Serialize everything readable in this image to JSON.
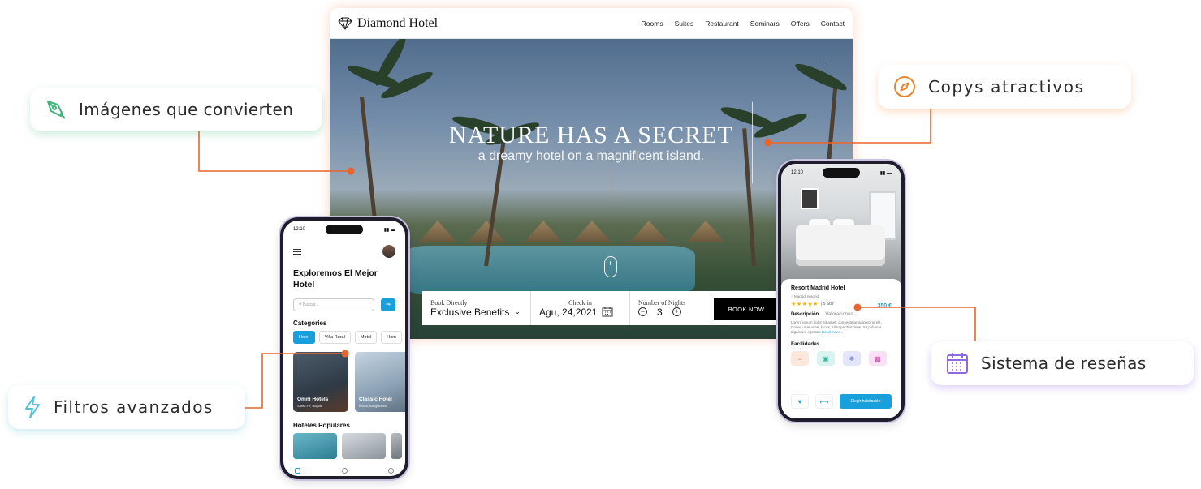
{
  "desktop": {
    "brand": "Diamond Hotel",
    "nav": [
      "Rooms",
      "Suites",
      "Restaurant",
      "Seminars",
      "Offers",
      "Contact"
    ],
    "hero_title": "NATURE HAS A SECRET",
    "hero_subtitle": "a dreamy hotel on a magnificent island.",
    "booking": {
      "book_label": "Book Directly",
      "book_value": "Exclusive Benefits",
      "checkin_label": "Check in",
      "checkin_value": "Agu, 24,2021",
      "nights_label": "Number of Nights",
      "nights_value": "3",
      "book_button": "BOOK NOW"
    }
  },
  "phone_left": {
    "time": "12:10",
    "title": "Exploremos El Mejor Hotel",
    "search_placeholder": "Buscar...",
    "categories_title": "Categories",
    "chips": [
      "Hotel",
      "Villa Rural",
      "Motel",
      "Hom"
    ],
    "cards": [
      {
        "name": "Omni Hotels",
        "location": "Santa Fe, Bogota"
      },
      {
        "name": "Classic Hotel",
        "location": "Bruna, Bangladesh"
      }
    ],
    "popular_title": "Hoteles Populares"
  },
  "phone_right": {
    "time": "12:10",
    "title": "Resort Madrid Hotel",
    "location": "Madrid, Madrid",
    "price": "350 €",
    "stars": "★★★★★",
    "rating_text": "| 5 Star",
    "tab_active": "Descripción",
    "tab_other": "Valoraciones",
    "description": "Lorem ipsum dolor sit amet, consectetur adipiscing elit. Donec ut et vitae, lacus, sit imperdiet risus. Sit pulvinar dignissim egestas",
    "read_more": "Read more...",
    "facilities_title": "Facilidades",
    "cta": "Elegir habitación"
  },
  "callouts": {
    "images": "Imágenes que convierten",
    "copys": "Copys atractivos",
    "filters": "Filtros avanzados",
    "reviews": "Sistema de reseñas"
  },
  "colors": {
    "accent_orange": "#E8662A",
    "blue": "#17A0DC",
    "green": "#3FB37A",
    "cyan": "#56C2D6",
    "purple": "#8E6AE0"
  },
  "icons": {
    "images": "pen-nib-icon",
    "copys": "compass-icon",
    "filters": "lightning-icon",
    "reviews": "calendar-icon"
  }
}
